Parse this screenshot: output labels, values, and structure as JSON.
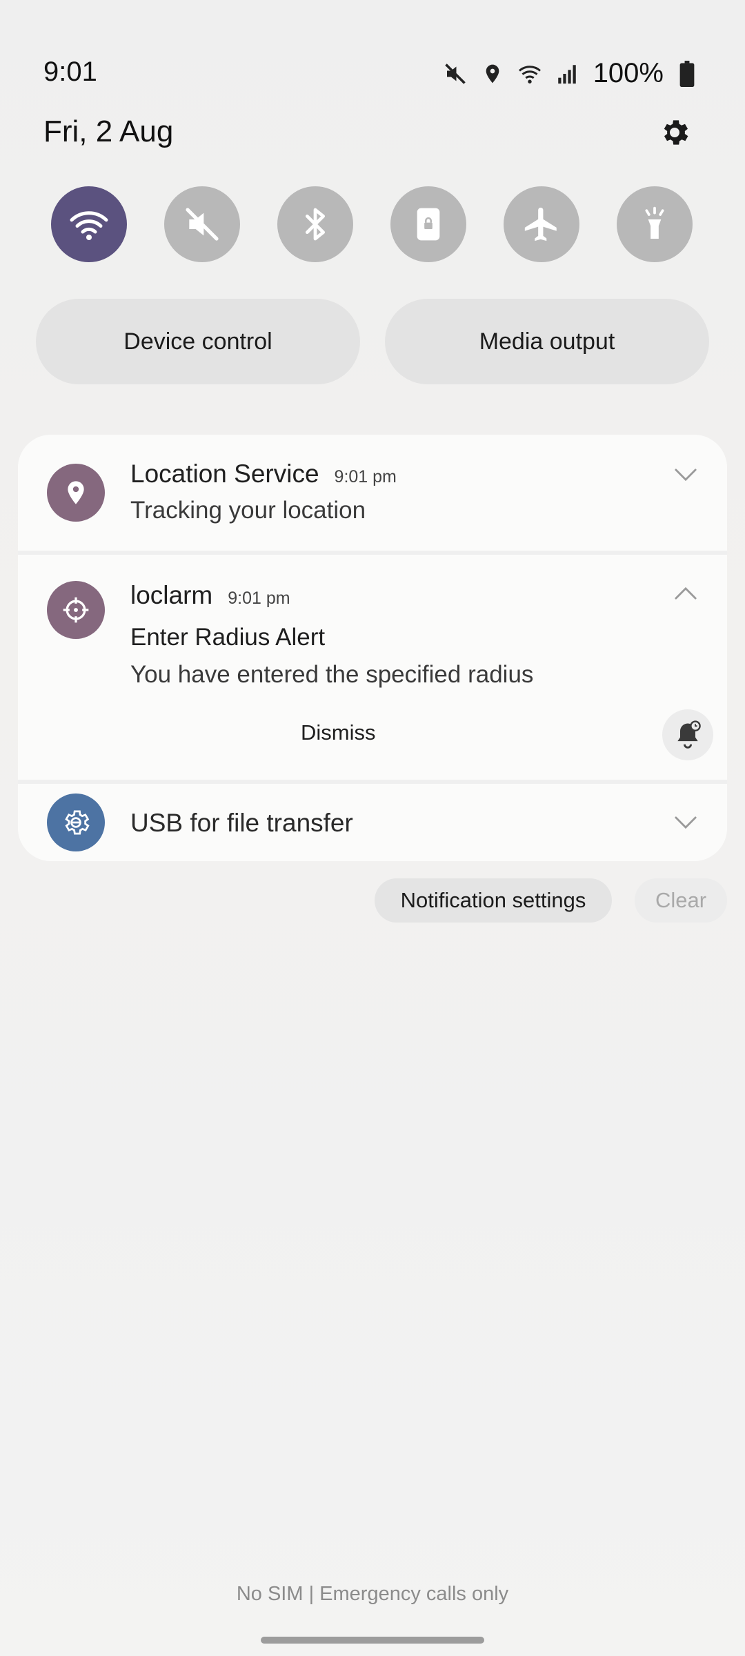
{
  "status_bar": {
    "time": "9:01",
    "battery": "100%",
    "icons": [
      "mute-icon",
      "location-icon",
      "wifi-icon",
      "signal-icon",
      "battery-icon"
    ]
  },
  "panel": {
    "date": "Fri, 2 Aug",
    "quick_toggles": [
      {
        "name": "wifi",
        "active": true
      },
      {
        "name": "sound-off",
        "active": false
      },
      {
        "name": "bluetooth",
        "active": false
      },
      {
        "name": "portrait-lock",
        "active": false
      },
      {
        "name": "airplane-mode",
        "active": false
      },
      {
        "name": "flashlight",
        "active": false
      }
    ],
    "device_control_label": "Device control",
    "media_output_label": "Media output"
  },
  "notifications": [
    {
      "app": "Location Service",
      "time": "9:01 pm",
      "text": "Tracking your location",
      "icon": "location-pin-icon",
      "icon_color": "#85687e"
    },
    {
      "app": "loclarm",
      "time": "9:01 pm",
      "title": "Enter Radius Alert",
      "text": "You have entered the specified radius",
      "action": "Dismiss",
      "icon": "crosshair-icon",
      "icon_color": "#85687e"
    },
    {
      "app": "USB for file transfer",
      "icon": "usb-settings-icon",
      "icon_color": "#4d73a3"
    }
  ],
  "actions": {
    "notification_settings": "Notification settings",
    "clear": "Clear"
  },
  "footer": {
    "carrier_text": "No SIM | Emergency calls only"
  },
  "colors": {
    "toggle_active": "#5b527f",
    "toggle_inactive": "#b8b8b8"
  }
}
